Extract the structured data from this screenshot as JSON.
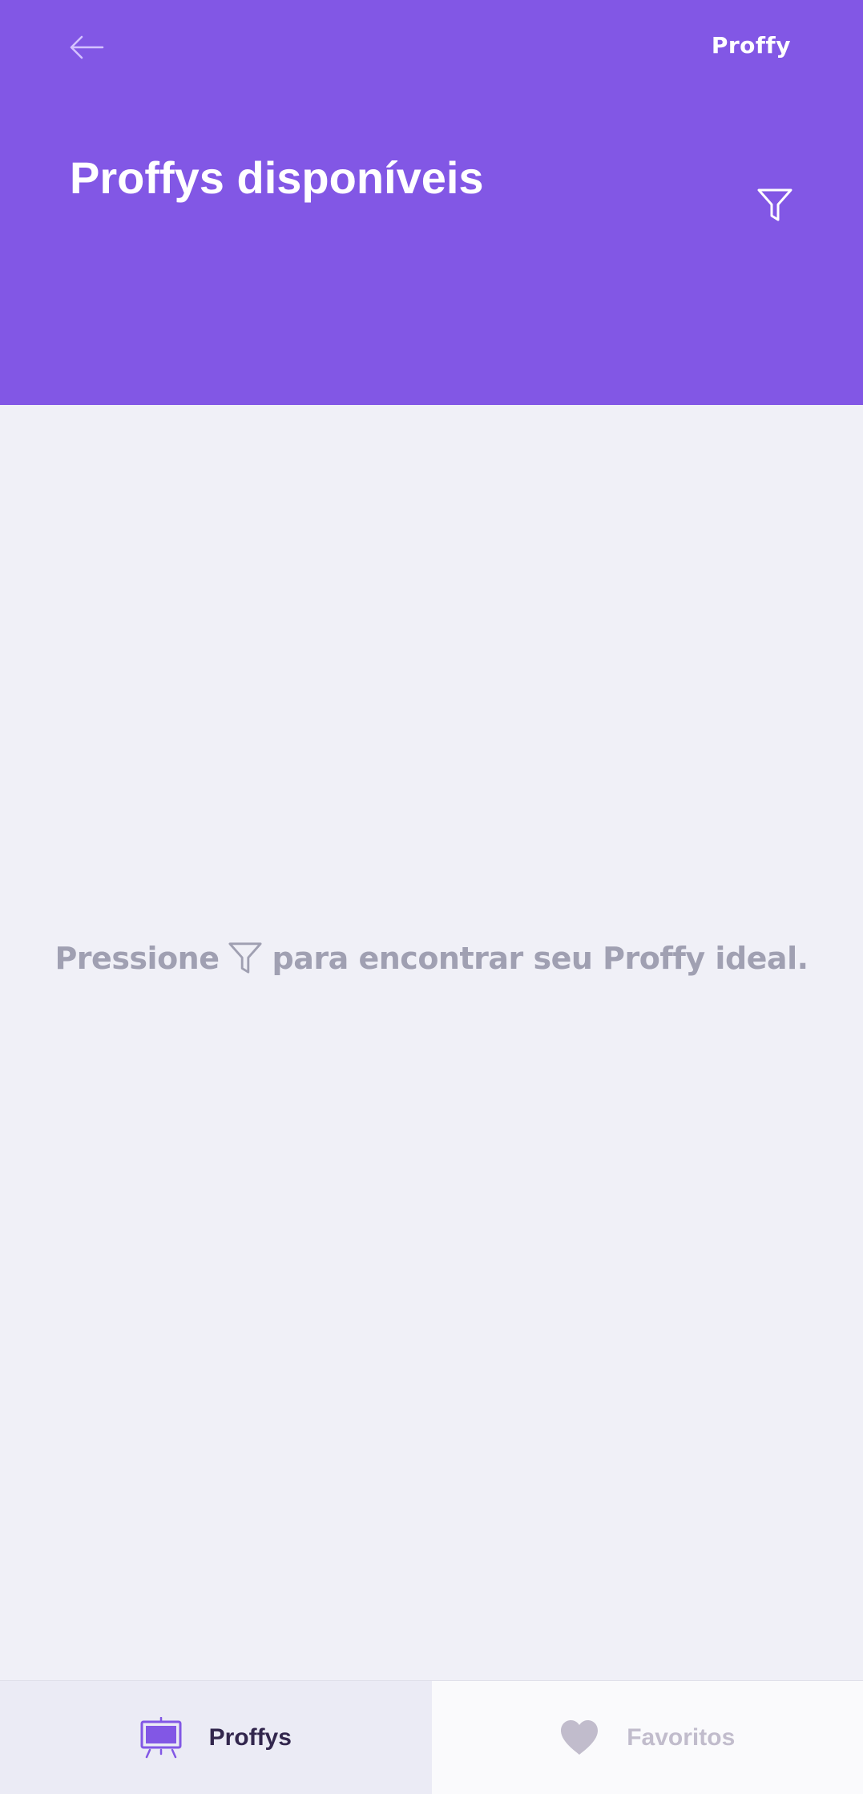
{
  "header": {
    "logo_text": "Proffy",
    "title": "Proffys disponíveis",
    "back_icon": "arrow-left-icon",
    "filter_icon": "filter-icon",
    "background_color": "#8257E5"
  },
  "empty_state": {
    "text_before_icon": "Pressione",
    "icon": "filter-icon",
    "text_after_icon": "para encontrar seu Proffy ideal."
  },
  "tabbar": {
    "tabs": [
      {
        "label": "Proffys",
        "icon": "easel-icon",
        "active": true
      },
      {
        "label": "Favoritos",
        "icon": "heart-icon",
        "active": false
      }
    ]
  },
  "colors": {
    "primary": "#8257E5",
    "background": "#F0F0F7",
    "muted_text": "#A0A0B2",
    "dark_text": "#32264D"
  }
}
